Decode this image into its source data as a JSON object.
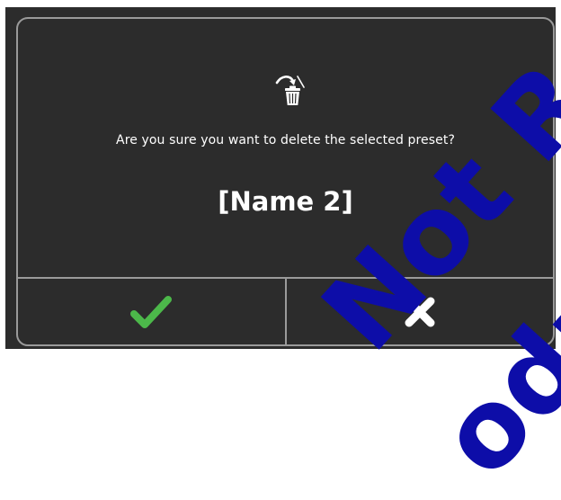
{
  "dialog": {
    "message": "Are you sure you want to delete the selected preset?",
    "preset_name": "[Name 2]",
    "icon": "trash-delete-icon"
  },
  "buttons": {
    "confirm_icon": "checkmark-icon",
    "cancel_icon": "cross-icon"
  },
  "colors": {
    "background": "#2c2c2c",
    "border": "#9a9a9a",
    "text": "#ffffff",
    "confirm": "#4cb84a",
    "cancel": "#ffffff",
    "watermark": "#0d0da8"
  },
  "watermark": {
    "line1": "Not Re",
    "line2": "oduc"
  }
}
